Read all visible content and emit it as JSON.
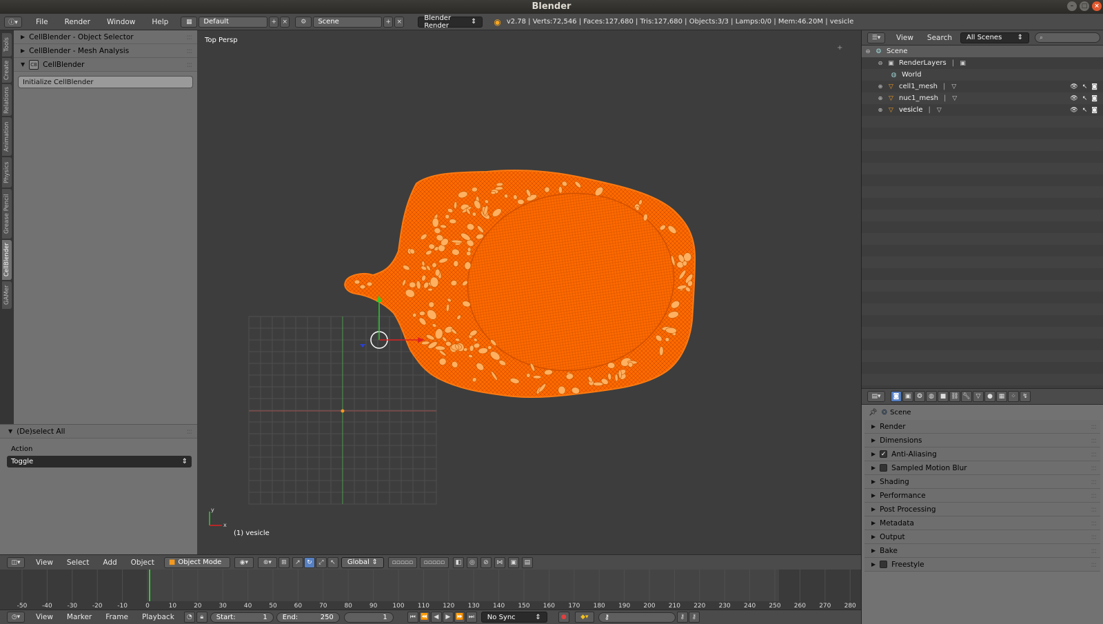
{
  "window": {
    "title": "Blender"
  },
  "info_header": {
    "menus": [
      "File",
      "Render",
      "Window",
      "Help"
    ],
    "layout": "Default",
    "scene": "Scene",
    "engine": "Blender Render",
    "stats": "v2.78 | Verts:72,546 | Faces:127,680 | Tris:127,680 | Objects:3/3 | Lamps:0/0 | Mem:46.20M | vesicle"
  },
  "toolshelf": {
    "tabs": [
      "Tools",
      "Create",
      "Relations",
      "Animation",
      "Physics",
      "Grease Pencil",
      "CellBlender",
      "GAMer"
    ],
    "active_tab": "CellBlender",
    "panels": [
      {
        "label": "CellBlender - Object Selector",
        "open": false
      },
      {
        "label": "CellBlender - Mesh Analysis",
        "open": false
      },
      {
        "label": "CellBlender",
        "open": true
      }
    ],
    "logo_text": "CB",
    "init_button": "Initialize CellBlender"
  },
  "operator": {
    "title": "(De)select All",
    "action_label": "Action",
    "action_value": "Toggle"
  },
  "viewport": {
    "view_label": "Top Persp",
    "object_label": "(1) vesicle",
    "axis_y": "y",
    "axis_x": "x",
    "mesh_color": "#ff6a00",
    "organelle_color": "#ffb060"
  },
  "viewport_header": {
    "menus": [
      "View",
      "Select",
      "Add",
      "Object"
    ],
    "mode": "Object Mode",
    "orientation": "Global"
  },
  "timeline": {
    "ticks": [
      "-50",
      "-40",
      "-30",
      "-20",
      "-10",
      "0",
      "10",
      "20",
      "30",
      "40",
      "50",
      "60",
      "70",
      "80",
      "90",
      "100",
      "110",
      "120",
      "130",
      "140",
      "150",
      "160",
      "170",
      "180",
      "190",
      "200",
      "210",
      "220",
      "230",
      "240",
      "250",
      "260",
      "270",
      "280"
    ],
    "menus": [
      "View",
      "Marker",
      "Frame",
      "Playback"
    ],
    "start_label": "Start:",
    "start_value": "1",
    "end_label": "End:",
    "end_value": "250",
    "current_frame": "1",
    "sync": "No Sync"
  },
  "outliner": {
    "menus": [
      "View",
      "Search"
    ],
    "filter": "All Scenes",
    "rows": [
      {
        "label": "Scene",
        "indent": 0,
        "icon": "scene-icon"
      },
      {
        "label": "RenderLayers",
        "indent": 1,
        "icon": "render-layers-icon"
      },
      {
        "label": "World",
        "indent": 1,
        "icon": "world-icon"
      },
      {
        "label": "cell1_mesh",
        "indent": 1,
        "icon": "mesh-object-icon"
      },
      {
        "label": "nuc1_mesh",
        "indent": 1,
        "icon": "mesh-object-icon"
      },
      {
        "label": "vesicle",
        "indent": 1,
        "icon": "mesh-object-icon"
      }
    ]
  },
  "properties": {
    "breadcrumb": "Scene",
    "sections": [
      {
        "label": "Render",
        "checkbox": null
      },
      {
        "label": "Dimensions",
        "checkbox": null
      },
      {
        "label": "Anti-Aliasing",
        "checkbox": true
      },
      {
        "label": "Sampled Motion Blur",
        "checkbox": false
      },
      {
        "label": "Shading",
        "checkbox": null
      },
      {
        "label": "Performance",
        "checkbox": null
      },
      {
        "label": "Post Processing",
        "checkbox": null
      },
      {
        "label": "Metadata",
        "checkbox": null
      },
      {
        "label": "Output",
        "checkbox": null
      },
      {
        "label": "Bake",
        "checkbox": null
      },
      {
        "label": "Freestyle",
        "checkbox": false
      }
    ]
  }
}
